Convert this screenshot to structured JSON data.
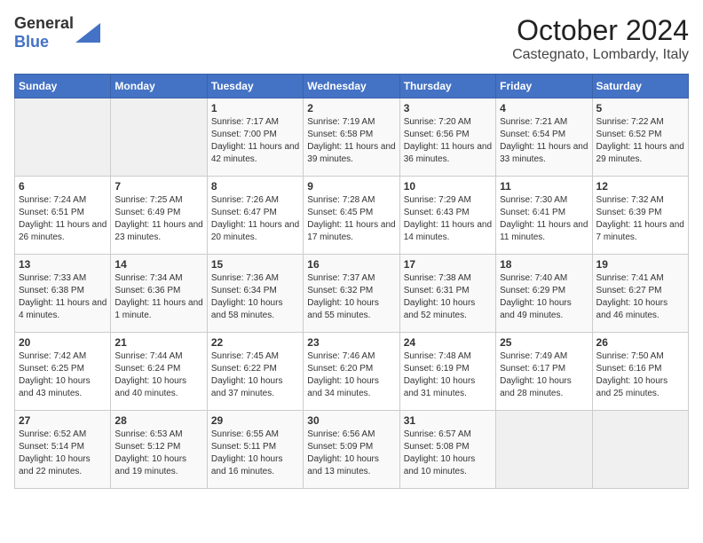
{
  "header": {
    "logo_general": "General",
    "logo_blue": "Blue",
    "month": "October 2024",
    "location": "Castegnato, Lombardy, Italy"
  },
  "weekdays": [
    "Sunday",
    "Monday",
    "Tuesday",
    "Wednesday",
    "Thursday",
    "Friday",
    "Saturday"
  ],
  "weeks": [
    [
      {
        "day": "",
        "empty": true
      },
      {
        "day": "",
        "empty": true
      },
      {
        "day": "1",
        "sunrise": "Sunrise: 7:17 AM",
        "sunset": "Sunset: 7:00 PM",
        "daylight": "Daylight: 11 hours and 42 minutes."
      },
      {
        "day": "2",
        "sunrise": "Sunrise: 7:19 AM",
        "sunset": "Sunset: 6:58 PM",
        "daylight": "Daylight: 11 hours and 39 minutes."
      },
      {
        "day": "3",
        "sunrise": "Sunrise: 7:20 AM",
        "sunset": "Sunset: 6:56 PM",
        "daylight": "Daylight: 11 hours and 36 minutes."
      },
      {
        "day": "4",
        "sunrise": "Sunrise: 7:21 AM",
        "sunset": "Sunset: 6:54 PM",
        "daylight": "Daylight: 11 hours and 33 minutes."
      },
      {
        "day": "5",
        "sunrise": "Sunrise: 7:22 AM",
        "sunset": "Sunset: 6:52 PM",
        "daylight": "Daylight: 11 hours and 29 minutes."
      }
    ],
    [
      {
        "day": "6",
        "sunrise": "Sunrise: 7:24 AM",
        "sunset": "Sunset: 6:51 PM",
        "daylight": "Daylight: 11 hours and 26 minutes."
      },
      {
        "day": "7",
        "sunrise": "Sunrise: 7:25 AM",
        "sunset": "Sunset: 6:49 PM",
        "daylight": "Daylight: 11 hours and 23 minutes."
      },
      {
        "day": "8",
        "sunrise": "Sunrise: 7:26 AM",
        "sunset": "Sunset: 6:47 PM",
        "daylight": "Daylight: 11 hours and 20 minutes."
      },
      {
        "day": "9",
        "sunrise": "Sunrise: 7:28 AM",
        "sunset": "Sunset: 6:45 PM",
        "daylight": "Daylight: 11 hours and 17 minutes."
      },
      {
        "day": "10",
        "sunrise": "Sunrise: 7:29 AM",
        "sunset": "Sunset: 6:43 PM",
        "daylight": "Daylight: 11 hours and 14 minutes."
      },
      {
        "day": "11",
        "sunrise": "Sunrise: 7:30 AM",
        "sunset": "Sunset: 6:41 PM",
        "daylight": "Daylight: 11 hours and 11 minutes."
      },
      {
        "day": "12",
        "sunrise": "Sunrise: 7:32 AM",
        "sunset": "Sunset: 6:39 PM",
        "daylight": "Daylight: 11 hours and 7 minutes."
      }
    ],
    [
      {
        "day": "13",
        "sunrise": "Sunrise: 7:33 AM",
        "sunset": "Sunset: 6:38 PM",
        "daylight": "Daylight: 11 hours and 4 minutes."
      },
      {
        "day": "14",
        "sunrise": "Sunrise: 7:34 AM",
        "sunset": "Sunset: 6:36 PM",
        "daylight": "Daylight: 11 hours and 1 minute."
      },
      {
        "day": "15",
        "sunrise": "Sunrise: 7:36 AM",
        "sunset": "Sunset: 6:34 PM",
        "daylight": "Daylight: 10 hours and 58 minutes."
      },
      {
        "day": "16",
        "sunrise": "Sunrise: 7:37 AM",
        "sunset": "Sunset: 6:32 PM",
        "daylight": "Daylight: 10 hours and 55 minutes."
      },
      {
        "day": "17",
        "sunrise": "Sunrise: 7:38 AM",
        "sunset": "Sunset: 6:31 PM",
        "daylight": "Daylight: 10 hours and 52 minutes."
      },
      {
        "day": "18",
        "sunrise": "Sunrise: 7:40 AM",
        "sunset": "Sunset: 6:29 PM",
        "daylight": "Daylight: 10 hours and 49 minutes."
      },
      {
        "day": "19",
        "sunrise": "Sunrise: 7:41 AM",
        "sunset": "Sunset: 6:27 PM",
        "daylight": "Daylight: 10 hours and 46 minutes."
      }
    ],
    [
      {
        "day": "20",
        "sunrise": "Sunrise: 7:42 AM",
        "sunset": "Sunset: 6:25 PM",
        "daylight": "Daylight: 10 hours and 43 minutes."
      },
      {
        "day": "21",
        "sunrise": "Sunrise: 7:44 AM",
        "sunset": "Sunset: 6:24 PM",
        "daylight": "Daylight: 10 hours and 40 minutes."
      },
      {
        "day": "22",
        "sunrise": "Sunrise: 7:45 AM",
        "sunset": "Sunset: 6:22 PM",
        "daylight": "Daylight: 10 hours and 37 minutes."
      },
      {
        "day": "23",
        "sunrise": "Sunrise: 7:46 AM",
        "sunset": "Sunset: 6:20 PM",
        "daylight": "Daylight: 10 hours and 34 minutes."
      },
      {
        "day": "24",
        "sunrise": "Sunrise: 7:48 AM",
        "sunset": "Sunset: 6:19 PM",
        "daylight": "Daylight: 10 hours and 31 minutes."
      },
      {
        "day": "25",
        "sunrise": "Sunrise: 7:49 AM",
        "sunset": "Sunset: 6:17 PM",
        "daylight": "Daylight: 10 hours and 28 minutes."
      },
      {
        "day": "26",
        "sunrise": "Sunrise: 7:50 AM",
        "sunset": "Sunset: 6:16 PM",
        "daylight": "Daylight: 10 hours and 25 minutes."
      }
    ],
    [
      {
        "day": "27",
        "sunrise": "Sunrise: 6:52 AM",
        "sunset": "Sunset: 5:14 PM",
        "daylight": "Daylight: 10 hours and 22 minutes."
      },
      {
        "day": "28",
        "sunrise": "Sunrise: 6:53 AM",
        "sunset": "Sunset: 5:12 PM",
        "daylight": "Daylight: 10 hours and 19 minutes."
      },
      {
        "day": "29",
        "sunrise": "Sunrise: 6:55 AM",
        "sunset": "Sunset: 5:11 PM",
        "daylight": "Daylight: 10 hours and 16 minutes."
      },
      {
        "day": "30",
        "sunrise": "Sunrise: 6:56 AM",
        "sunset": "Sunset: 5:09 PM",
        "daylight": "Daylight: 10 hours and 13 minutes."
      },
      {
        "day": "31",
        "sunrise": "Sunrise: 6:57 AM",
        "sunset": "Sunset: 5:08 PM",
        "daylight": "Daylight: 10 hours and 10 minutes."
      },
      {
        "day": "",
        "empty": true
      },
      {
        "day": "",
        "empty": true
      }
    ]
  ]
}
